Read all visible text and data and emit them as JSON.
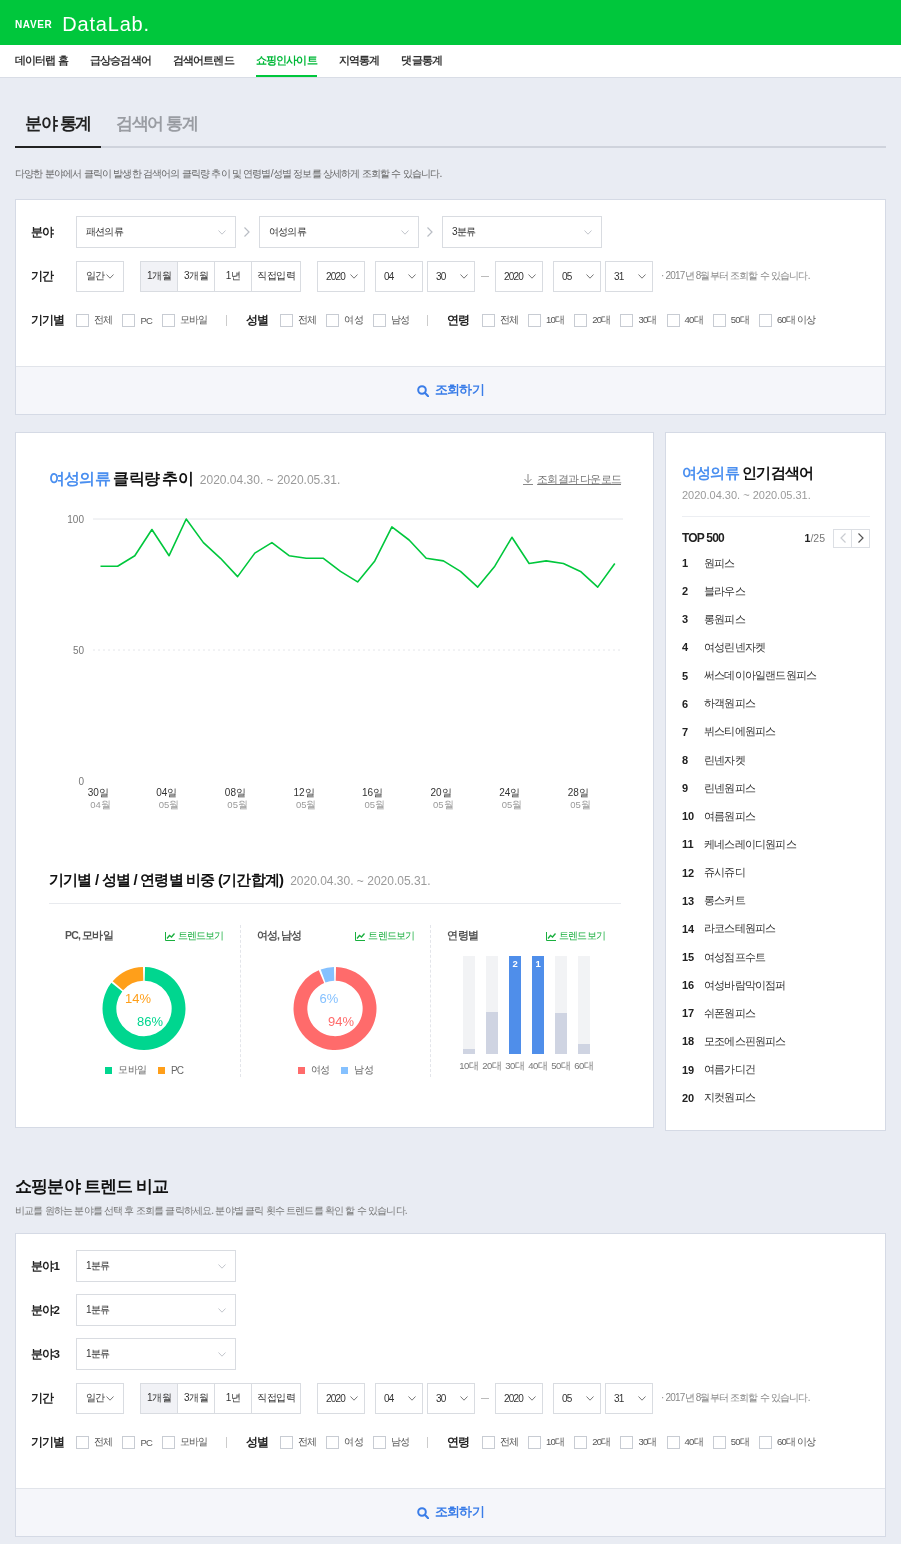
{
  "header": {
    "brand": "NAVER",
    "product": "DataLab."
  },
  "nav": [
    {
      "label": "데이터랩 홈",
      "selected": false
    },
    {
      "label": "급상승검색어",
      "selected": false
    },
    {
      "label": "검색어트렌드",
      "selected": false
    },
    {
      "label": "쇼핑인사이트",
      "selected": true
    },
    {
      "label": "지역통계",
      "selected": false
    },
    {
      "label": "댓글통계",
      "selected": false
    }
  ],
  "tabs": [
    {
      "label": "분야 통계",
      "selected": true
    },
    {
      "label": "검색어 통계",
      "selected": false
    }
  ],
  "description": "다양한 분야에서 클릭이 발생한 검색어의 클릭량 추이 및 연령별/성별 정보를 상세하게 조회할 수 있습니다.",
  "filter": {
    "category_rows": [
      {
        "label": "분야",
        "selects": [
          "패션의류",
          "여성의류",
          "3분류"
        ]
      }
    ],
    "period": {
      "label": "기간",
      "unit": "일간",
      "ranges": [
        {
          "label": "1개월",
          "selected": true
        },
        {
          "label": "3개월",
          "selected": false
        },
        {
          "label": "1년",
          "selected": false
        },
        {
          "label": "직접입력",
          "selected": false
        }
      ],
      "start": [
        "2020",
        "04",
        "30"
      ],
      "end": [
        "2020",
        "05",
        "31"
      ],
      "note": "· 2017년 8월부터 조회할 수 있습니다."
    },
    "checkbox_groups": [
      {
        "label": "기기별",
        "options": [
          {
            "label": "전체",
            "checked": false
          },
          {
            "label": "PC",
            "checked": false
          },
          {
            "label": "모바일",
            "checked": false
          }
        ]
      },
      {
        "label": "성별",
        "options": [
          {
            "label": "전체",
            "checked": false
          },
          {
            "label": "여성",
            "checked": false
          },
          {
            "label": "남성",
            "checked": false
          }
        ]
      },
      {
        "label": "연령",
        "options": [
          {
            "label": "전체",
            "checked": false
          },
          {
            "label": "10대",
            "checked": false
          },
          {
            "label": "20대",
            "checked": false
          },
          {
            "label": "30대",
            "checked": false
          },
          {
            "label": "40대",
            "checked": false
          },
          {
            "label": "50대",
            "checked": false
          },
          {
            "label": "60대 이상",
            "checked": false
          }
        ]
      }
    ],
    "button": "조회하기"
  },
  "trend": {
    "highlight": "여성의류",
    "title": "클릭량 추이",
    "date_range": "2020.04.30. ~ 2020.05.31.",
    "download": "조회결과 다운로드",
    "chart_data": {
      "type": "line",
      "categories": [
        "30일\n04월",
        null,
        null,
        null,
        "04일\n05월",
        null,
        null,
        null,
        "08일\n05월",
        null,
        null,
        null,
        "12일\n05월",
        null,
        null,
        null,
        "16일\n05월",
        null,
        null,
        null,
        "20일\n05월",
        null,
        null,
        null,
        "24일\n05월",
        null,
        null,
        null,
        "28일\n05월",
        null,
        null
      ],
      "series": [
        {
          "color": "#00c73c",
          "values": [
            82,
            82,
            86,
            96,
            86,
            100,
            91,
            85,
            78,
            87,
            91,
            86,
            85,
            85,
            80,
            76,
            84,
            97,
            92,
            85,
            84,
            80,
            74,
            82,
            93,
            83,
            84,
            83,
            80,
            74,
            83
          ]
        }
      ],
      "ylim": [
        0,
        100
      ],
      "yticks": [
        0,
        50,
        100
      ]
    }
  },
  "ratio": {
    "title": "기기별 / 성별 / 연령별 비중 (기간합계)",
    "date_range": "2020.04.30. ~ 2020.05.31.",
    "panels": [
      {
        "kind": "donut",
        "title": "PC, 모바일",
        "link": "트렌드보기",
        "chart_data": {
          "type": "donut",
          "categories": [
            "모바일",
            "PC"
          ],
          "values": [
            86,
            14
          ],
          "value_labels": [
            "86%",
            "14%"
          ]
        },
        "slices": [
          {
            "color": "#00d68f"
          },
          {
            "color": "#ff9f1a"
          }
        ]
      },
      {
        "kind": "donut",
        "title": "여성, 남성",
        "link": "트렌드보기",
        "chart_data": {
          "type": "donut",
          "categories": [
            "여성",
            "남성"
          ],
          "values": [
            94,
            6
          ],
          "value_labels": [
            "94%",
            "6%"
          ]
        },
        "slices": [
          {
            "color": "#ff6b6b"
          },
          {
            "color": "#85c1ff"
          }
        ]
      },
      {
        "kind": "bars",
        "title": "연령별",
        "link": "트렌드보기",
        "bars": [
          {
            "label": "10대",
            "level": 0.05,
            "highlighted": false
          },
          {
            "label": "20대",
            "level": 0.43,
            "highlighted": false
          },
          {
            "label": "30대",
            "level": 1,
            "highlighted": true,
            "rank": "2"
          },
          {
            "label": "40대",
            "level": 1,
            "highlighted": true,
            "rank": "1"
          },
          {
            "label": "50대",
            "level": 0.42,
            "highlighted": false
          },
          {
            "label": "60대",
            "level": 0.1,
            "highlighted": false
          }
        ]
      }
    ]
  },
  "popular": {
    "highlight": "여성의류",
    "title": "인기검색어",
    "date_range": "2020.04.30. ~ 2020.05.31.",
    "top_label": "TOP 500",
    "page": "**1**/25",
    "pager": [
      {
        "kind": "prev",
        "disabled": true
      },
      {
        "kind": "next",
        "disabled": false
      }
    ],
    "items": [
      {
        "rank": "1",
        "term": "원피스"
      },
      {
        "rank": "2",
        "term": "블라우스"
      },
      {
        "rank": "3",
        "term": "롱원피스"
      },
      {
        "rank": "4",
        "term": "여성린넨자켓"
      },
      {
        "rank": "5",
        "term": "써스데이아일랜드원피스"
      },
      {
        "rank": "6",
        "term": "하객원피스"
      },
      {
        "rank": "7",
        "term": "뷔스티에원피스"
      },
      {
        "rank": "8",
        "term": "린넨자켓"
      },
      {
        "rank": "9",
        "term": "린넨원피스"
      },
      {
        "rank": "10",
        "term": "여름원피스"
      },
      {
        "rank": "11",
        "term": "케네스레이디원피스"
      },
      {
        "rank": "12",
        "term": "쥬시쥬디"
      },
      {
        "rank": "13",
        "term": "롱스커트"
      },
      {
        "rank": "14",
        "term": "라코스테원피스"
      },
      {
        "rank": "15",
        "term": "여성점프수트"
      },
      {
        "rank": "16",
        "term": "여성바람막이점퍼"
      },
      {
        "rank": "17",
        "term": "쉬폰원피스"
      },
      {
        "rank": "18",
        "term": "모조에스핀원피스"
      },
      {
        "rank": "19",
        "term": "여름가디건"
      },
      {
        "rank": "20",
        "term": "지컷원피스"
      }
    ]
  },
  "compare": {
    "title": "쇼핑분야 트렌드 비교",
    "description": "비교를 원하는 분야를 선택 후 조회를 클릭하세요. 분야별 클릭 횟수 트렌드를 확인 할 수 있습니다.",
    "filter": {
      "category_rows": [
        {
          "label": "분야1",
          "selects": [
            "1분류"
          ]
        },
        {
          "label": "분야2",
          "selects": [
            "1분류"
          ]
        },
        {
          "label": "분야3",
          "selects": [
            "1분류"
          ]
        }
      ],
      "period": {
        "label": "기간",
        "unit": "일간",
        "ranges": [
          {
            "label": "1개월",
            "selected": true
          },
          {
            "label": "3개월",
            "selected": false
          },
          {
            "label": "1년",
            "selected": false
          },
          {
            "label": "직접입력",
            "selected": false
          }
        ],
        "start": [
          "2020",
          "04",
          "30"
        ],
        "end": [
          "2020",
          "05",
          "31"
        ],
        "note": "· 2017년 8월부터 조회할 수 있습니다."
      },
      "checkbox_groups": [
        {
          "label": "기기별",
          "options": [
            {
              "label": "전체",
              "checked": false
            },
            {
              "label": "PC",
              "checked": false
            },
            {
              "label": "모바일",
              "checked": false
            }
          ]
        },
        {
          "label": "성별",
          "options": [
            {
              "label": "전체",
              "checked": false
            },
            {
              "label": "여성",
              "checked": false
            },
            {
              "label": "남성",
              "checked": false
            }
          ]
        },
        {
          "label": "연령",
          "options": [
            {
              "label": "전체",
              "checked": false
            },
            {
              "label": "10대",
              "checked": false
            },
            {
              "label": "20대",
              "checked": false
            },
            {
              "label": "30대",
              "checked": false
            },
            {
              "label": "40대",
              "checked": false
            },
            {
              "label": "50대",
              "checked": false
            },
            {
              "label": "60대 이상",
              "checked": false
            }
          ]
        }
      ],
      "button": "조회하기"
    }
  }
}
